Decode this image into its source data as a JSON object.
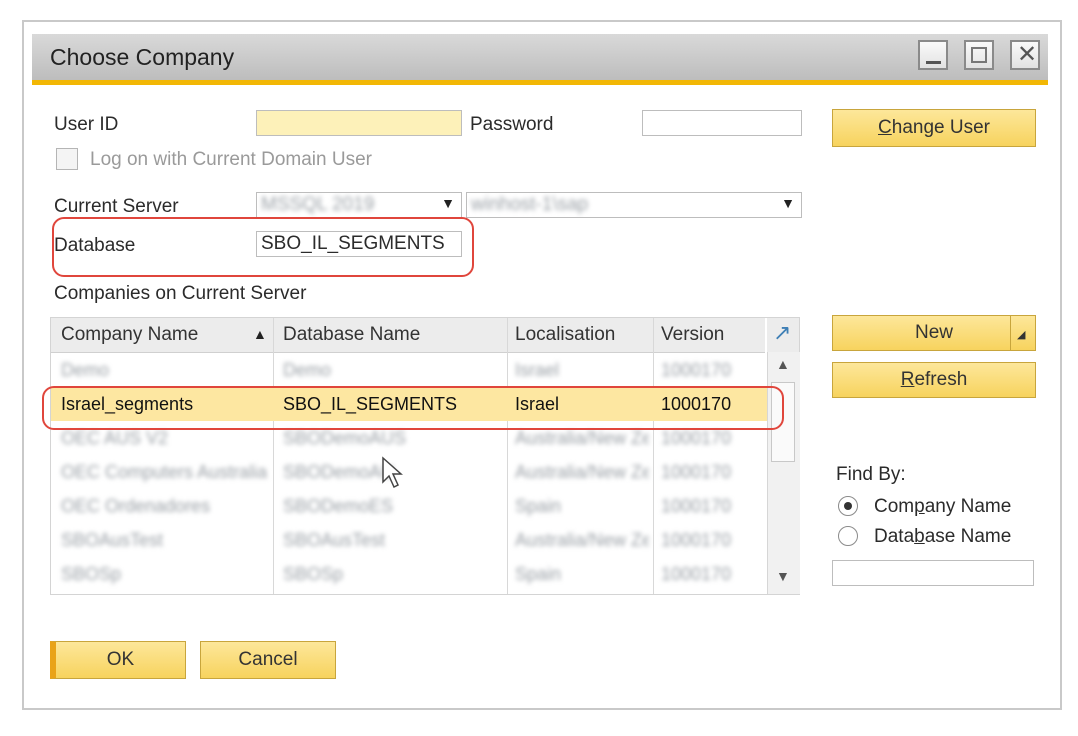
{
  "dialog": {
    "title": "Choose Company"
  },
  "login": {
    "user_id_label": "User ID",
    "user_id_value": "",
    "password_label": "Password",
    "password_value": "",
    "change_user_prefix": "",
    "change_user_accel": "C",
    "change_user_rest": "hange User",
    "log_on_domain_label": "Log on with Current Domain User"
  },
  "server": {
    "current_server_label": "Current Server",
    "server_type": "MSSQL 2019",
    "server_name": "winhost-1\\sap",
    "database_label": "Database",
    "database_value": "SBO_IL_SEGMENTS"
  },
  "companies": {
    "section_label": "Companies on Current Server",
    "columns": [
      "Company Name",
      "Database Name",
      "Localisation",
      "Version"
    ],
    "rows": [
      {
        "company": "Demo",
        "database": "Demo",
        "localisation": "Israel",
        "version": "1000170"
      },
      {
        "company": "Israel_segments",
        "database": "SBO_IL_SEGMENTS",
        "localisation": "Israel",
        "version": "1000170"
      },
      {
        "company": "OEC AUS V2",
        "database": "SBODemoAUS",
        "localisation": "Australia/New Zealand",
        "version": "1000170"
      },
      {
        "company": "OEC Computers Australia",
        "database": "SBODemoAU",
        "localisation": "Australia/New Zealand",
        "version": "1000170"
      },
      {
        "company": "OEC Ordenadores",
        "database": "SBODemoES",
        "localisation": "Spain",
        "version": "1000170"
      },
      {
        "company": "SBOAusTest",
        "database": "SBOAusTest",
        "localisation": "Australia/New Zealand",
        "version": "1000170"
      },
      {
        "company": "SBOSp",
        "database": "SBOSp",
        "localisation": "Spain",
        "version": "1000170"
      }
    ],
    "selected_index": 1
  },
  "actions": {
    "new_label": "New",
    "refresh_accel": "R",
    "refresh_rest": "efresh",
    "ok_label": "OK",
    "cancel_label": "Cancel"
  },
  "find": {
    "label": "Find By:",
    "opt1_pre": "Com",
    "opt1_accel": "p",
    "opt1_post": "any Name",
    "opt2_pre": "Data",
    "opt2_accel": "b",
    "opt2_post": "ase Name",
    "selected": "company",
    "search_value": ""
  },
  "colors": {
    "accent": "#f2b705",
    "highlight_row": "#fde7a1",
    "annotation": "#e0463c"
  }
}
